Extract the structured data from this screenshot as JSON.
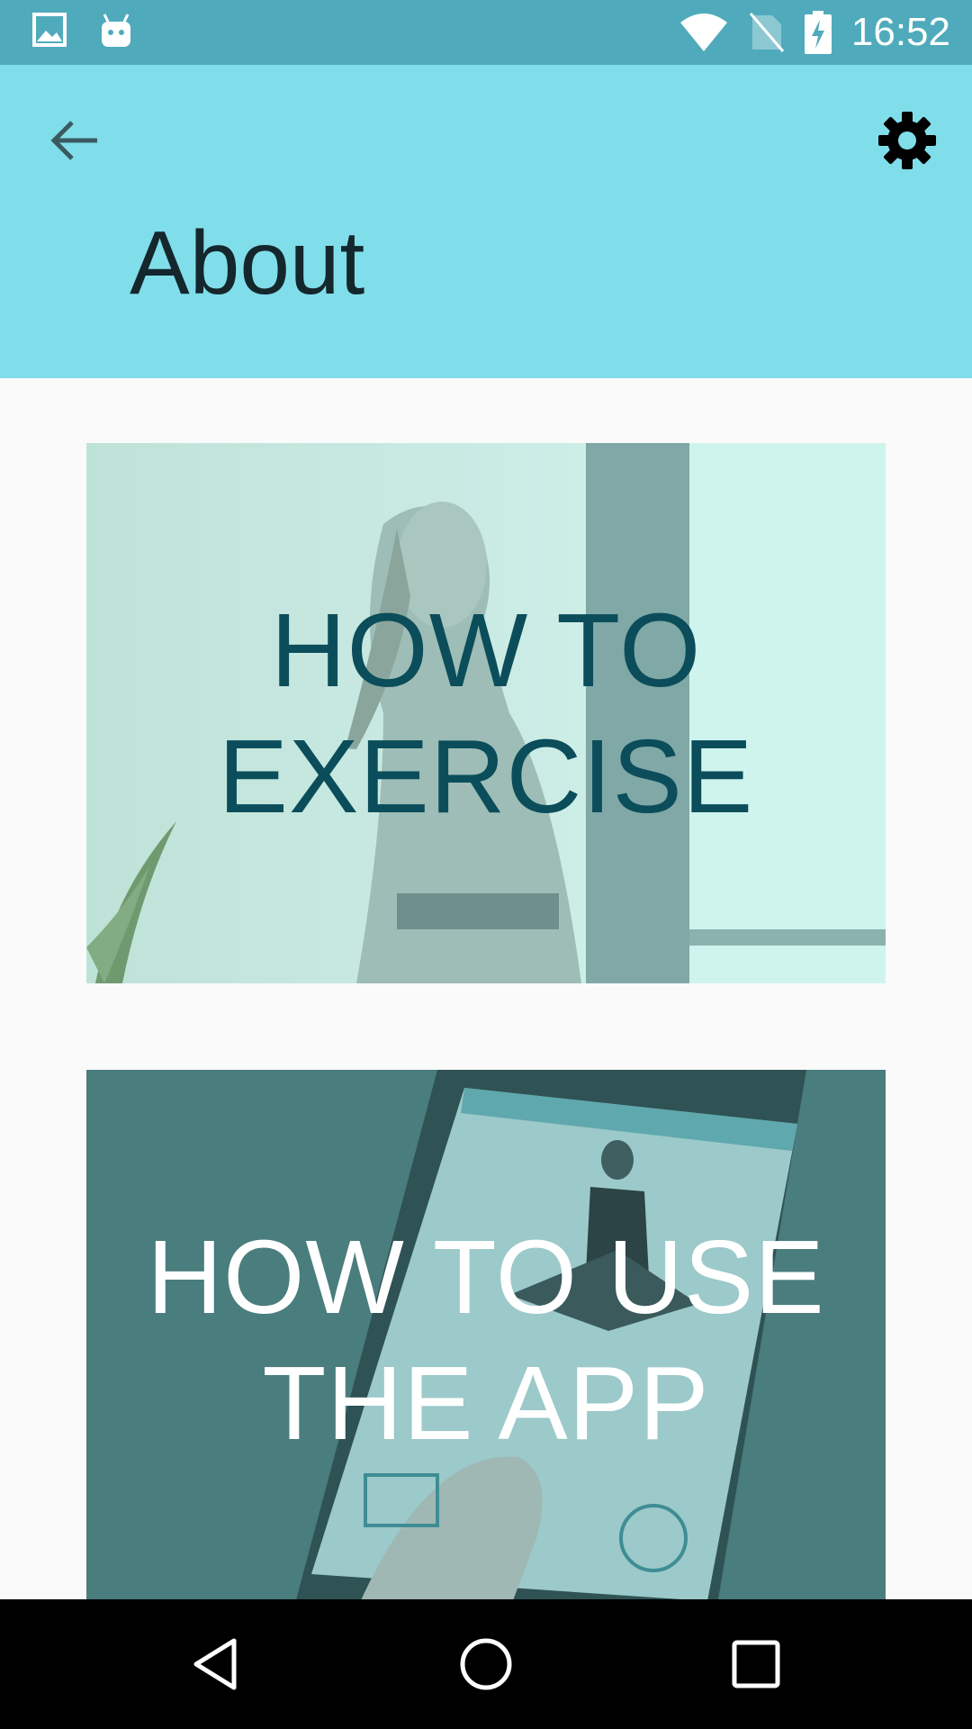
{
  "status_bar": {
    "time": "16:52",
    "icons": [
      "image-notification-icon",
      "android-notification-icon",
      "wifi-icon",
      "no-sim-icon",
      "battery-charging-icon"
    ]
  },
  "app_bar": {
    "title": "About",
    "back_icon": "arrow-back-icon",
    "settings_icon": "gear-icon",
    "background": "#80deea"
  },
  "cards": [
    {
      "label": "HOW TO\nEXERCISE",
      "image": "woman-stretching-photo"
    },
    {
      "label": "HOW TO USE\nTHE APP",
      "image": "phone-app-photo"
    }
  ],
  "nav_bar": {
    "icons": [
      "back-triangle-icon",
      "home-circle-icon",
      "recents-square-icon"
    ]
  }
}
